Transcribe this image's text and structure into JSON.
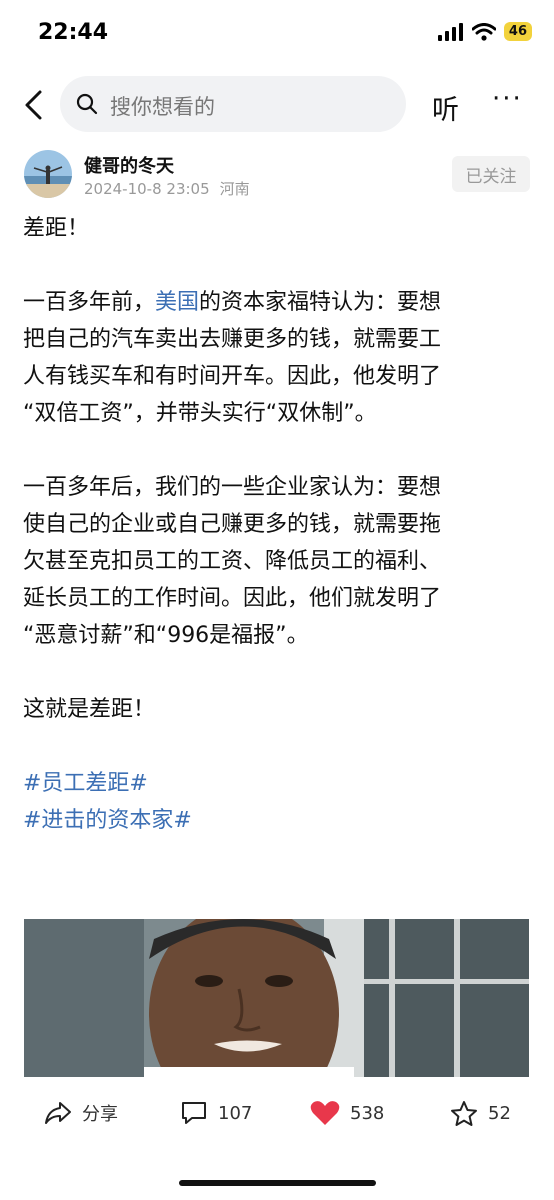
{
  "status": {
    "time": "22:44",
    "network": "46"
  },
  "topbar": {
    "search_placeholder": "搜你想看的",
    "listen_label": "听",
    "more_label": "···"
  },
  "post": {
    "author": {
      "name": "健哥的冬天",
      "date": "2024-10-8 23:05",
      "location": "河南",
      "follow_label": "已关注"
    },
    "lines": {
      "l1": "差距！",
      "l2_pre": "一百多年前，",
      "l2_link": "美国",
      "l2_post": "的资本家福特认为：要想",
      "l3": "把自己的汽车卖出去赚更多的钱，就需要工",
      "l4": "人有钱买车和有时间开车。因此，他发明了",
      "l5": "“双倍工资”，并带头实行“双休制”。",
      "l6": "一百多年后，我们的一些企业家认为：要想",
      "l7": "使自己的企业或自己赚更多的钱，就需要拖",
      "l8": "欠甚至克扣员工的工资、降低员工的福利、",
      "l9": "延长员工的工作时间。因此，他们就发明了",
      "l10": "“恶意讨薪”和“996是福报”。",
      "l11": "这就是差距！"
    },
    "tags": [
      "#员工差距#",
      "#进击的资本家#"
    ]
  },
  "actions": {
    "share_label": "分享",
    "comments": "107",
    "likes": "538",
    "favorites": "52"
  },
  "colors": {
    "link": "#3c6fb4",
    "like": "#e8374b",
    "battery": "#f2d23c"
  }
}
